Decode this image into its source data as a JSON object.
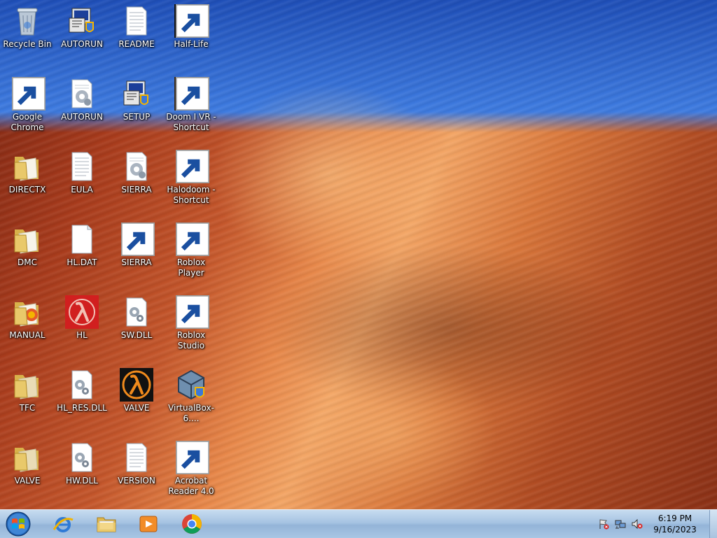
{
  "desktop": {
    "icons": [
      {
        "label": "Recycle Bin",
        "icon": "recycle-bin-icon"
      },
      {
        "label": "Google Chrome",
        "icon": "chrome-icon"
      },
      {
        "label": "DIRECTX",
        "icon": "folder-icon"
      },
      {
        "label": "DMC",
        "icon": "folder-icon"
      },
      {
        "label": "MANUAL",
        "icon": "folder-icon"
      },
      {
        "label": "TFC",
        "icon": "folder-icon"
      },
      {
        "label": "VALVE",
        "icon": "folder-icon"
      },
      {
        "label": "AUTORUN",
        "icon": "setup-icon"
      },
      {
        "label": "AUTORUN",
        "icon": "config-file-icon"
      },
      {
        "label": "EULA",
        "icon": "text-file-icon"
      },
      {
        "label": "HL.DAT",
        "icon": "blank-file-icon"
      },
      {
        "label": "HL",
        "icon": "half-life-red-icon"
      },
      {
        "label": "HL_RES.DLL",
        "icon": "dll-file-icon"
      },
      {
        "label": "HW.DLL",
        "icon": "dll-file-icon"
      },
      {
        "label": "README",
        "icon": "text-file-icon"
      },
      {
        "label": "SETUP",
        "icon": "setup-icon"
      },
      {
        "label": "SIERRA",
        "icon": "config-file-icon"
      },
      {
        "label": "SIERRA",
        "icon": "internet-explorer-icon"
      },
      {
        "label": "SW.DLL",
        "icon": "dll-file-icon"
      },
      {
        "label": "VALVE",
        "icon": "half-life-icon"
      },
      {
        "label": "VERSION",
        "icon": "text-file-icon"
      },
      {
        "label": "Half-Life",
        "icon": "half-life-icon"
      },
      {
        "label": "Doom I VR - Shortcut",
        "icon": "doom-icon"
      },
      {
        "label": "Halodoom - Shortcut",
        "icon": "halodoom-icon"
      },
      {
        "label": "Roblox Player",
        "icon": "roblox-player-icon"
      },
      {
        "label": "Roblox Studio",
        "icon": "roblox-studio-icon"
      },
      {
        "label": "VirtualBox-6....",
        "icon": "virtualbox-icon"
      },
      {
        "label": "Acrobat Reader 4.0",
        "icon": "acrobat-icon"
      }
    ]
  },
  "taskbar": {
    "start": "start-orb-icon",
    "pinned": [
      "internet-explorer-icon",
      "file-explorer-icon",
      "media-player-icon",
      "chrome-icon"
    ],
    "tray": [
      "action-center-flag-icon",
      "network-icon",
      "volume-muted-icon"
    ],
    "time": "6:19 PM",
    "date": "9/16/2023"
  }
}
